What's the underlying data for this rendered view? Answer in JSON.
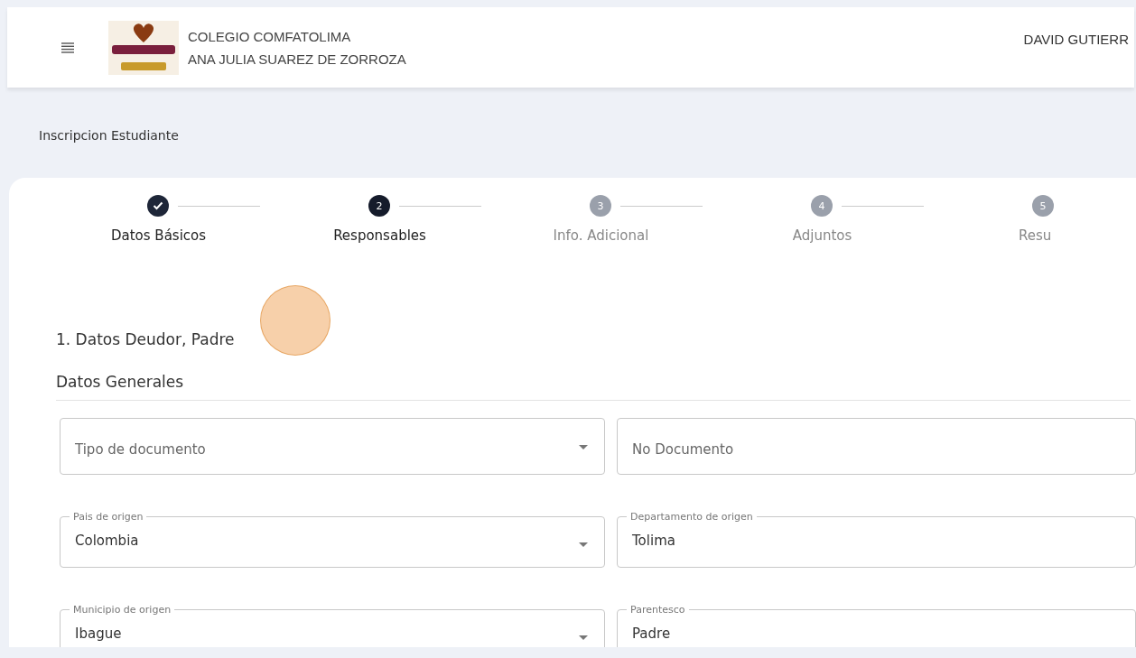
{
  "header": {
    "school_name": "COLEGIO COMFATOLIMA",
    "campus_name": "ANA JULIA SUAREZ DE ZORROZA",
    "user_name": "DAVID GUTIERR"
  },
  "page_title": "Inscripcion Estudiante",
  "steps": [
    {
      "label": "Datos Básicos",
      "completed": true,
      "selected": false
    },
    {
      "number": "2",
      "label": "Responsables",
      "completed": false,
      "selected": true
    },
    {
      "number": "3",
      "label": "Info. Adicional",
      "completed": false,
      "selected": false
    },
    {
      "number": "4",
      "label": "Adjuntos",
      "completed": false,
      "selected": false
    },
    {
      "number": "5",
      "label": "Resu",
      "completed": false,
      "selected": false
    }
  ],
  "section_title": "1. Datos Deudor, Padre",
  "subsection_title": "Datos Generales",
  "fields": [
    {
      "kind": "select",
      "placeholder": "Tipo de documento"
    },
    {
      "kind": "text",
      "placeholder": "No Documento"
    },
    {
      "kind": "select",
      "label": "Pais de origen",
      "value": "Colombia"
    },
    {
      "kind": "text",
      "label": "Departamento de origen",
      "value": "Tolima"
    },
    {
      "kind": "select",
      "label": "Municipio de origen",
      "value": "Ibague"
    },
    {
      "kind": "text",
      "label": "Parentesco",
      "value": "Padre"
    }
  ]
}
